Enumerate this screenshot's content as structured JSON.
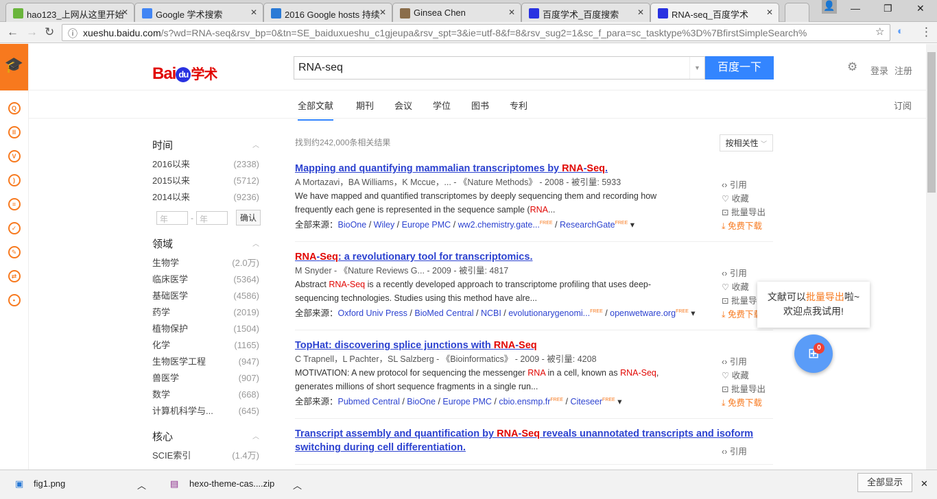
{
  "browser": {
    "tabs": [
      {
        "label": "hao123_上网从这里开始",
        "color": "#6ab53c"
      },
      {
        "label": "Google 学术搜索",
        "color": "#4285f4"
      },
      {
        "label": "2016 Google hosts 持续",
        "color": "#2a7ad6"
      },
      {
        "label": "Ginsea Chen",
        "color": "#8a6d4b"
      },
      {
        "label": "百度学术_百度搜索",
        "color": "#2932e1"
      },
      {
        "label": "RNA-seq_百度学术",
        "color": "#2932e1"
      }
    ],
    "url_host": "xueshu.baidu.com",
    "url_path": "/s?wd=RNA-seq&rsv_bp=0&tn=SE_baiduxueshu_c1gjeupa&rsv_spt=3&ie=utf-8&f=8&rsv_sug2=1&sc_f_para=sc_tasktype%3D%7BfirstSimpleSearch%"
  },
  "header": {
    "logo": "Bai du 学术",
    "query": "RNA-seq",
    "search_btn": "百度一下",
    "login": "登录",
    "register": "注册"
  },
  "subnav": {
    "tabs": [
      "全部文献",
      "期刊",
      "会议",
      "学位",
      "图书",
      "专利"
    ],
    "subscribe": "订阅"
  },
  "filters": {
    "time": {
      "title": "时间",
      "items": [
        {
          "l": "2016以来",
          "n": "(2338)"
        },
        {
          "l": "2015以来",
          "n": "(5712)"
        },
        {
          "l": "2014以来",
          "n": "(9236)"
        }
      ],
      "from": "年",
      "to": "年",
      "confirm": "确认"
    },
    "field": {
      "title": "领域",
      "items": [
        {
          "l": "生物学",
          "n": "(2.0万)"
        },
        {
          "l": "临床医学",
          "n": "(5364)"
        },
        {
          "l": "基础医学",
          "n": "(4586)"
        },
        {
          "l": "药学",
          "n": "(2019)"
        },
        {
          "l": "植物保护",
          "n": "(1504)"
        },
        {
          "l": "化学",
          "n": "(1165)"
        },
        {
          "l": "生物医学工程",
          "n": "(947)"
        },
        {
          "l": "兽医学",
          "n": "(907)"
        },
        {
          "l": "数学",
          "n": "(668)"
        },
        {
          "l": "计算机科学与...",
          "n": "(645)"
        }
      ]
    },
    "core": {
      "title": "核心",
      "items": [
        {
          "l": "SCIE索引",
          "n": "(1.4万)"
        }
      ]
    }
  },
  "results": {
    "count": "找到约242,000条相关结果",
    "sort": "按相关性",
    "source_label": "全部来源：",
    "actions": {
      "cite": "引用",
      "fav": "收藏",
      "export": "批量导出",
      "download": "免费下载"
    },
    "items": [
      {
        "title": [
          [
            "Mapping and quantifying mammalian transcriptomes by ",
            0
          ],
          [
            "RNA",
            1
          ],
          [
            "-",
            0
          ],
          [
            "Seq",
            1
          ],
          [
            ".",
            0
          ]
        ],
        "meta": "A Mortazavi，BA Williams，K Mccue，... - 《Nature Methods》 - 2008 - 被引量: 5933",
        "abs": [
          [
            "We have mapped and quantified transcriptomes by deeply sequencing them and recording how frequently each gene is represented in the sequence sample (",
            0
          ],
          [
            "RNA",
            1
          ],
          [
            "...",
            0
          ]
        ],
        "sources": [
          [
            "BioOne",
            0
          ],
          [
            "Wiley",
            0
          ],
          [
            "Europe PMC",
            0
          ],
          [
            "ww2.chemistry.gate...",
            1
          ],
          [
            "ResearchGate",
            1
          ]
        ],
        "download": true
      },
      {
        "title": [
          [
            "RNA",
            1
          ],
          [
            "-",
            0
          ],
          [
            "Seq",
            1
          ],
          [
            ": a revolutionary tool for transcriptomics.",
            0
          ]
        ],
        "meta": "M Snyder - 《Nature Reviews G... - 2009 - 被引量: 4817",
        "abs": [
          [
            "Abstract ",
            0
          ],
          [
            "RNA-Seq",
            1
          ],
          [
            " is a recently developed approach to transcriptome profiling that uses deep-sequencing technologies. Studies using this method have alre...",
            0
          ]
        ],
        "sources": [
          [
            "Oxford Univ Press",
            0
          ],
          [
            "BioMed Central",
            0
          ],
          [
            "NCBI",
            0
          ],
          [
            "evolutionarygenomi...",
            1
          ],
          [
            "openwetware.org",
            1
          ]
        ],
        "download": true
      },
      {
        "title": [
          [
            "TopHat: discovering splice junctions with ",
            0
          ],
          [
            "RNA",
            1
          ],
          [
            "-",
            0
          ],
          [
            "Seq",
            1
          ]
        ],
        "meta": "C Trapnell，L Pachter，SL Salzberg - 《Bioinformatics》 - 2009 - 被引量: 4208",
        "abs": [
          [
            "MOTIVATION: A new protocol for sequencing the messenger ",
            0
          ],
          [
            "RNA",
            1
          ],
          [
            " in a cell, known as ",
            0
          ],
          [
            "RNA-Seq",
            1
          ],
          [
            ", generates millions of short sequence fragments in a single run...",
            0
          ]
        ],
        "sources": [
          [
            "Pubmed Central",
            0
          ],
          [
            "BioOne",
            0
          ],
          [
            "Europe PMC",
            0
          ],
          [
            "cbio.ensmp.fr",
            1
          ],
          [
            "Citeseer",
            1
          ]
        ],
        "download": true
      },
      {
        "title": [
          [
            "Transcript assembly and quantification by ",
            0
          ],
          [
            "RNA",
            1
          ],
          [
            "-",
            0
          ],
          [
            "Seq",
            1
          ],
          [
            " reveals unannotated transcripts and isoform switching during cell differentiation.",
            0
          ]
        ],
        "meta": "",
        "abs": [],
        "sources": [],
        "download": false
      }
    ]
  },
  "free_tag": "FREE",
  "tooltip": {
    "line1a": "文献可以",
    "line1b": "批量导出",
    "line1c": "啦~",
    "line2": "欢迎点我试用!"
  },
  "export_badge": "0",
  "downloads": {
    "items": [
      "fig1.png",
      "hexo-theme-cas....zip"
    ],
    "show_all": "全部显示"
  }
}
